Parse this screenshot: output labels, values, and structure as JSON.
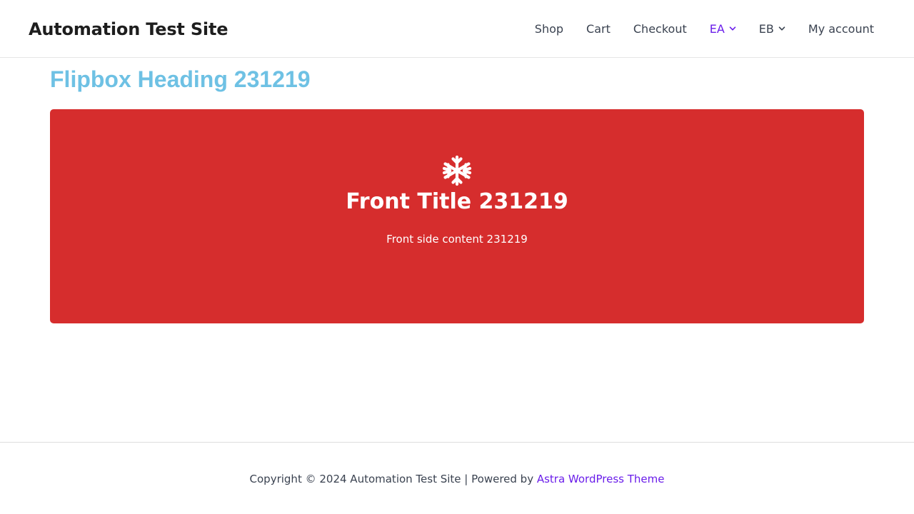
{
  "header": {
    "site_title": "Automation Test Site",
    "nav": [
      {
        "label": "Shop"
      },
      {
        "label": "Cart"
      },
      {
        "label": "Checkout"
      },
      {
        "label": "EA",
        "has_dropdown": true,
        "active": true
      },
      {
        "label": "EB",
        "has_dropdown": true
      },
      {
        "label": "My account"
      }
    ]
  },
  "main": {
    "heading": "Flipbox Heading 231219",
    "flipbox": {
      "icon": "snowflake-icon",
      "front_title": "Front Title 231219",
      "front_content": "Front side content 231219",
      "background_color": "#d62d2d"
    }
  },
  "footer": {
    "copyright_text": "Copyright © 2024 Automation Test Site | Powered by ",
    "theme_link": "Astra WordPress Theme"
  },
  "colors": {
    "accent": "#6a1dea",
    "heading": "#6ec1e4",
    "text": "#3a4250"
  }
}
